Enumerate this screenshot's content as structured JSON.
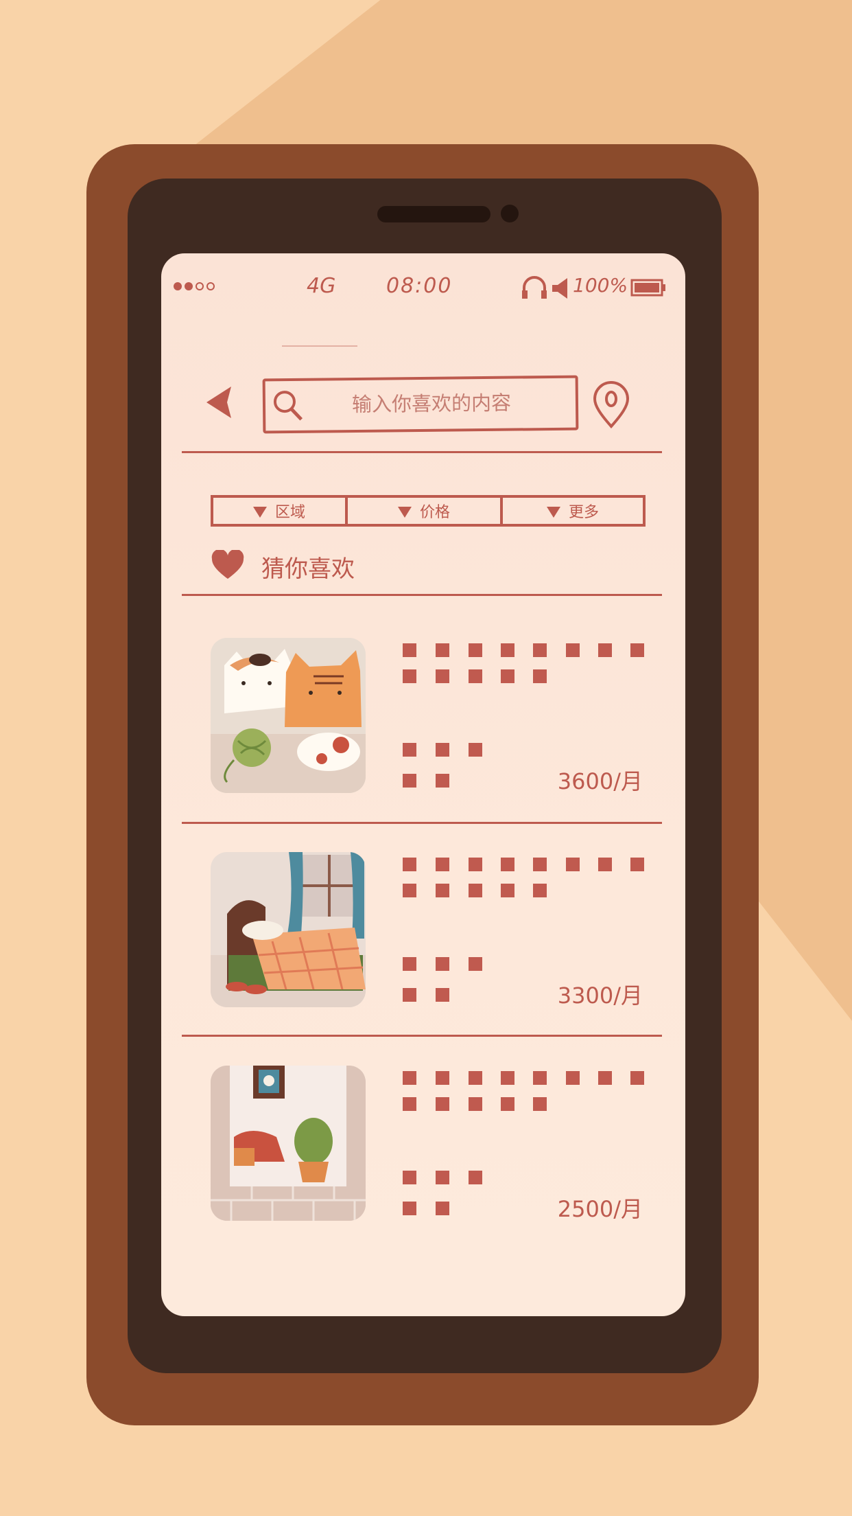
{
  "status_bar": {
    "network": "4G",
    "time": "08:00",
    "battery": "100%",
    "signal_dots": 4,
    "signal_filled": 2
  },
  "search": {
    "placeholder": "输入你喜欢的内容",
    "back_icon": "back-arrow-icon",
    "search_icon": "search-icon",
    "location_icon": "location-pin-icon"
  },
  "filters": [
    {
      "label": "区域"
    },
    {
      "label": "价格"
    },
    {
      "label": "更多"
    }
  ],
  "section": {
    "title": "猜你喜欢",
    "icon": "heart-icon"
  },
  "listings": [
    {
      "price": "3600/月",
      "image": "cats-illustration"
    },
    {
      "price": "3300/月",
      "image": "bedroom-illustration"
    },
    {
      "price": "2500/月",
      "image": "living-room-illustration"
    }
  ],
  "colors": {
    "background": "#f9d3a8",
    "phone_body": "#8b4b2c",
    "bezel": "#3f2a21",
    "screen": "#fbe3d6",
    "accent": "#bd5a4e"
  }
}
